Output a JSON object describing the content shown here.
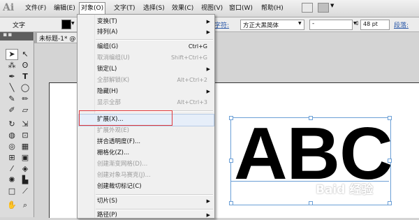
{
  "app": {
    "logo": "Ai"
  },
  "menubar": {
    "items": [
      {
        "label": "文件(F)"
      },
      {
        "label": "编辑(E)"
      },
      {
        "label": "对象(O)"
      },
      {
        "label": "文字(T)"
      },
      {
        "label": "选择(S)"
      },
      {
        "label": "效果(C)"
      },
      {
        "label": "视图(V)"
      },
      {
        "label": "窗口(W)"
      },
      {
        "label": "帮助(H)"
      }
    ],
    "active": "对象(O)"
  },
  "controlbar": {
    "object_type": "文字",
    "character_label": "字符:",
    "font_family": "方正大黑简体",
    "font_style": "-",
    "font_size": "48 pt",
    "paragraph_label": "段落:"
  },
  "document": {
    "tab_title": "未标题-1* @ 3"
  },
  "artwork": {
    "text": "ABC"
  },
  "watermark": "Baid 经验",
  "object_menu": {
    "items": [
      {
        "label": "变换(T)",
        "submenu": true
      },
      {
        "label": "排列(A)",
        "submenu": true
      },
      {
        "label": "编组(G)",
        "shortcut": "Ctrl+G"
      },
      {
        "label": "取消编组(U)",
        "shortcut": "Shift+Ctrl+G",
        "disabled": true
      },
      {
        "label": "锁定(L)",
        "submenu": true
      },
      {
        "label": "全部解锁(K)",
        "shortcut": "Alt+Ctrl+2",
        "disabled": true
      },
      {
        "label": "隐藏(H)",
        "submenu": true
      },
      {
        "label": "显示全部",
        "shortcut": "Alt+Ctrl+3",
        "disabled": true
      },
      {
        "label": "扩展(X)...",
        "highlighted": true
      },
      {
        "label": "扩展外观(E)",
        "disabled": true
      },
      {
        "label": "拼合透明度(F)..."
      },
      {
        "label": "栅格化(Z)..."
      },
      {
        "label": "创建渐变网格(D)...",
        "disabled": true
      },
      {
        "label": "创建对象马赛克(J)...",
        "disabled": true
      },
      {
        "label": "创建裁切标记(C)"
      },
      {
        "label": "切片(S)",
        "submenu": true
      },
      {
        "label": "路径(P)",
        "submenu": true
      }
    ]
  },
  "colors": {
    "highlight_border": "#e0373a",
    "selection_blue": "#6b9fd6",
    "link_blue": "#2a58a8"
  }
}
